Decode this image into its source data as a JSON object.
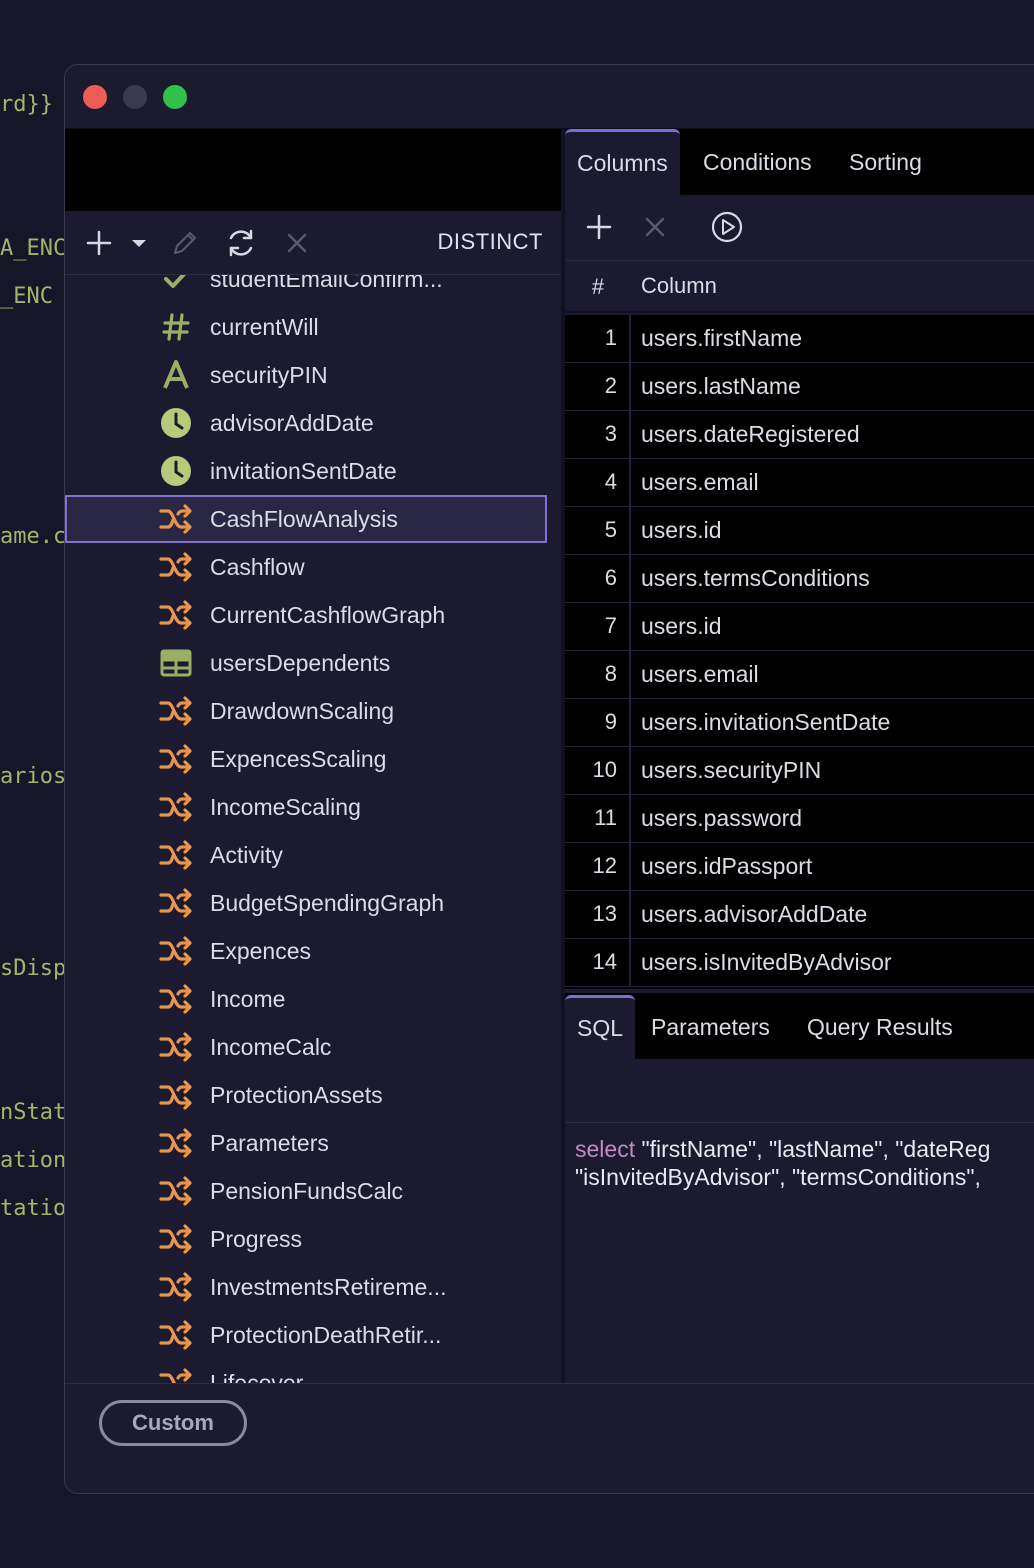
{
  "background_fragments": [
    "rd}}",
    "A_ENC",
    "_ENC",
    "ame.c",
    "ariosD",
    "sDispl",
    "nStatu",
    "ationS",
    "tation"
  ],
  "left_toolbar": {
    "add_icon": "plus-icon",
    "dropdown_icon": "chevron-down-icon",
    "edit_icon": "pencil-icon",
    "refresh_icon": "refresh-icon",
    "delete_icon": "close-icon",
    "distinct_label": "DISTINCT"
  },
  "tree": {
    "items": [
      {
        "label": "studentEmailConfirm...",
        "icon": "check-icon",
        "color": "#9aaf66"
      },
      {
        "label": "currentWill",
        "icon": "hash-icon",
        "color": "#9aaf66"
      },
      {
        "label": "securityPIN",
        "icon": "text-type-icon",
        "color": "#9aaf66"
      },
      {
        "label": "advisorAddDate",
        "icon": "clock-icon",
        "color": "#b7c97a"
      },
      {
        "label": "invitationSentDate",
        "icon": "clock-icon",
        "color": "#b7c97a"
      },
      {
        "label": "CashFlowAnalysis",
        "icon": "shuffle-icon",
        "color": "#e8944a",
        "selected": true
      },
      {
        "label": "Cashflow",
        "icon": "shuffle-icon",
        "color": "#e8944a"
      },
      {
        "label": "CurrentCashflowGraph",
        "icon": "shuffle-icon",
        "color": "#e8944a"
      },
      {
        "label": "usersDependents",
        "icon": "table-icon",
        "color": "#9aaf66"
      },
      {
        "label": "DrawdownScaling",
        "icon": "shuffle-icon",
        "color": "#e8944a"
      },
      {
        "label": "ExpencesScaling",
        "icon": "shuffle-icon",
        "color": "#e8944a"
      },
      {
        "label": "IncomeScaling",
        "icon": "shuffle-icon",
        "color": "#e8944a"
      },
      {
        "label": "Activity",
        "icon": "shuffle-icon",
        "color": "#e8944a"
      },
      {
        "label": "BudgetSpendingGraph",
        "icon": "shuffle-icon",
        "color": "#e8944a"
      },
      {
        "label": "Expences",
        "icon": "shuffle-icon",
        "color": "#e8944a"
      },
      {
        "label": "Income",
        "icon": "shuffle-icon",
        "color": "#e8944a"
      },
      {
        "label": "IncomeCalc",
        "icon": "shuffle-icon",
        "color": "#e8944a"
      },
      {
        "label": "ProtectionAssets",
        "icon": "shuffle-icon",
        "color": "#e8944a"
      },
      {
        "label": "Parameters",
        "icon": "shuffle-icon",
        "color": "#e8944a"
      },
      {
        "label": "PensionFundsCalc",
        "icon": "shuffle-icon",
        "color": "#e8944a"
      },
      {
        "label": "Progress",
        "icon": "shuffle-icon",
        "color": "#e8944a"
      },
      {
        "label": "InvestmentsRetireme...",
        "icon": "shuffle-icon",
        "color": "#e8944a"
      },
      {
        "label": "ProtectionDeathRetir...",
        "icon": "shuffle-icon",
        "color": "#e8944a"
      },
      {
        "label": "Lifecover",
        "icon": "shuffle-icon",
        "color": "#e8944a"
      }
    ]
  },
  "query_tabs": [
    "Columns",
    "Conditions",
    "Sorting"
  ],
  "query_toolbar": {
    "add_icon": "plus-icon",
    "delete_icon": "close-icon",
    "run_icon": "play-circle-icon"
  },
  "columns_table": {
    "headers": [
      "#",
      "Column"
    ],
    "rows": [
      {
        "n": "1",
        "col": "users.firstName"
      },
      {
        "n": "2",
        "col": "users.lastName"
      },
      {
        "n": "3",
        "col": "users.dateRegistered"
      },
      {
        "n": "4",
        "col": "users.email"
      },
      {
        "n": "5",
        "col": "users.id"
      },
      {
        "n": "6",
        "col": "users.termsConditions"
      },
      {
        "n": "7",
        "col": "users.id"
      },
      {
        "n": "8",
        "col": "users.email"
      },
      {
        "n": "9",
        "col": "users.invitationSentDate"
      },
      {
        "n": "10",
        "col": "users.securityPIN"
      },
      {
        "n": "11",
        "col": "users.password"
      },
      {
        "n": "12",
        "col": "users.idPassport"
      },
      {
        "n": "13",
        "col": "users.advisorAddDate"
      },
      {
        "n": "14",
        "col": "users.isInvitedByAdvisor"
      }
    ]
  },
  "sql_tabs": [
    "SQL",
    "Parameters",
    "Query Results"
  ],
  "sql": {
    "keyword": "select",
    "line1_rest": " \"firstName\", \"lastName\", \"dateReg",
    "line2": "\"isInvitedByAdvisor\", \"termsConditions\","
  },
  "bottom": {
    "custom_label": "Custom"
  },
  "colors": {
    "accent": "#7b6ed1",
    "selection_border": "#8470cf",
    "keyword": "#c08ac4"
  }
}
